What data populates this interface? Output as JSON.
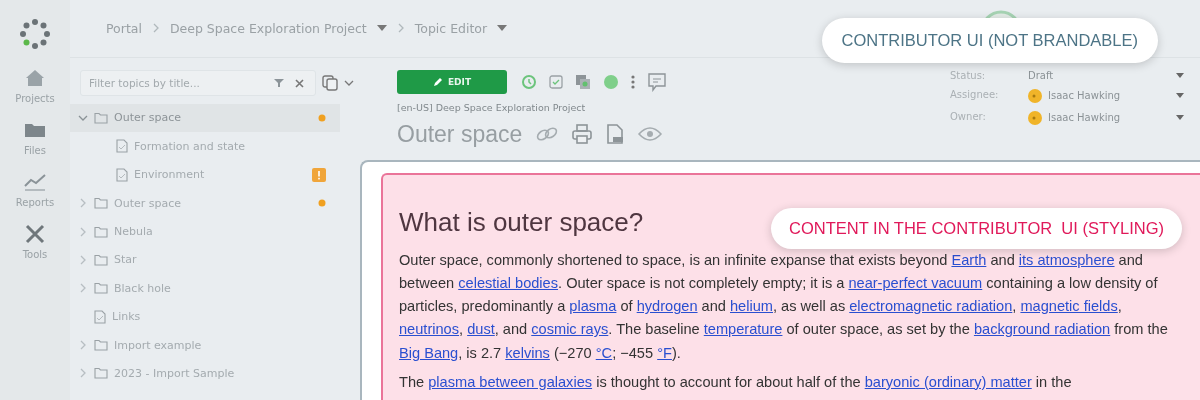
{
  "rail": {
    "items": [
      {
        "label": "Projects",
        "kind": "home"
      },
      {
        "label": "Files",
        "kind": "folder"
      },
      {
        "label": "Reports",
        "kind": "chart"
      },
      {
        "label": "Tools",
        "kind": "tools"
      }
    ]
  },
  "breadcrumb": [
    {
      "label": "Portal",
      "dropdown": false
    },
    {
      "label": "Deep Space Exploration Project",
      "dropdown": true
    },
    {
      "label": "Topic Editor",
      "dropdown": true
    }
  ],
  "filter": {
    "placeholder": "Filter topics by title..."
  },
  "tree": [
    {
      "label": "Outer space",
      "kind": "folder",
      "expanded": true,
      "selected": true,
      "dot": true,
      "children": [
        {
          "label": "Formation and state",
          "kind": "doc",
          "selected": false
        },
        {
          "label": "Environment",
          "kind": "doc",
          "selected": false,
          "badge": true
        }
      ]
    },
    {
      "label": "Outer space",
      "kind": "folder",
      "expanded": false,
      "selected": false,
      "dot": true
    },
    {
      "label": "Nebula",
      "kind": "folder",
      "expanded": false,
      "selected": false
    },
    {
      "label": "Star",
      "kind": "folder",
      "expanded": false,
      "selected": false
    },
    {
      "label": "Black hole",
      "kind": "folder",
      "expanded": false,
      "selected": false
    },
    {
      "label": "Links",
      "kind": "doc",
      "selected": false
    },
    {
      "label": "Import example",
      "kind": "folder",
      "expanded": false,
      "selected": false
    },
    {
      "label": "2023 - Import Sample",
      "kind": "folder",
      "expanded": false,
      "selected": false
    }
  ],
  "toolbar": {
    "edit": "EDIT"
  },
  "topic": {
    "project": "[en-US] Deep Space Exploration Project",
    "title": "Outer space"
  },
  "properties": [
    {
      "label": "Status:",
      "value": "Draft",
      "avatar": false
    },
    {
      "label": "Assignee:",
      "value": "Isaac Hawking",
      "avatar": true
    },
    {
      "label": "Owner:",
      "value": "Isaac Hawking",
      "avatar": true
    }
  ],
  "content": {
    "heading": "What is outer space?",
    "paragraphs": [
      [
        {
          "text": "Outer space, commonly shortened to space, is an infinite expanse that exists beyond ",
          "kind": "plain"
        },
        {
          "text": "Earth",
          "kind": "link"
        },
        {
          "text": " and ",
          "kind": "plain"
        },
        {
          "text": "its atmosphere",
          "kind": "link"
        },
        {
          "text": " and between ",
          "kind": "plain"
        },
        {
          "text": "celestial bodies",
          "kind": "link"
        },
        {
          "text": ". Outer space is not completely empty; it is a ",
          "kind": "plain"
        },
        {
          "text": "near-perfect vacuum",
          "kind": "link"
        },
        {
          "text": " containing a low density of particles, predominantly a ",
          "kind": "plain"
        },
        {
          "text": "plasma",
          "kind": "link"
        },
        {
          "text": " of ",
          "kind": "plain"
        },
        {
          "text": "hydrogen",
          "kind": "link"
        },
        {
          "text": " and ",
          "kind": "plain"
        },
        {
          "text": "helium",
          "kind": "link"
        },
        {
          "text": ", as well as ",
          "kind": "plain"
        },
        {
          "text": "electromagnetic radiation",
          "kind": "link"
        },
        {
          "text": ", ",
          "kind": "plain"
        },
        {
          "text": "magnetic fields",
          "kind": "link"
        },
        {
          "text": ", ",
          "kind": "plain"
        },
        {
          "text": "neutrinos",
          "kind": "link"
        },
        {
          "text": ", ",
          "kind": "plain"
        },
        {
          "text": "dust",
          "kind": "link"
        },
        {
          "text": ", and ",
          "kind": "plain"
        },
        {
          "text": "cosmic rays",
          "kind": "link"
        },
        {
          "text": ". The baseline ",
          "kind": "plain"
        },
        {
          "text": "temperature",
          "kind": "link"
        },
        {
          "text": " of outer space, as set by the ",
          "kind": "plain"
        },
        {
          "text": "background radiation",
          "kind": "link"
        },
        {
          "text": " from the ",
          "kind": "plain"
        },
        {
          "text": "Big Bang",
          "kind": "link"
        },
        {
          "text": ", is 2.7 ",
          "kind": "plain"
        },
        {
          "text": "kelvins",
          "kind": "link"
        },
        {
          "text": " (−270 ",
          "kind": "plain"
        },
        {
          "text": "°C",
          "kind": "link"
        },
        {
          "text": "; −455 ",
          "kind": "plain"
        },
        {
          "text": "°F",
          "kind": "link"
        },
        {
          "text": ").",
          "kind": "plain"
        }
      ],
      [
        {
          "text": "The ",
          "kind": "plain"
        },
        {
          "text": "plasma between galaxies",
          "kind": "link"
        },
        {
          "text": " is thought to account for about half of the ",
          "kind": "plain"
        },
        {
          "text": "baryonic (ordinary) matter",
          "kind": "link"
        },
        {
          "text": " in the",
          "kind": "plain"
        }
      ]
    ]
  },
  "callouts": [
    {
      "text": "CONTRIBUTOR UI (NOT BRANDABLE)",
      "kind": "ui"
    },
    {
      "text": "CONTENT IN THE CONTRIBUTOR  UI (STYLING)",
      "kind": "content"
    }
  ]
}
